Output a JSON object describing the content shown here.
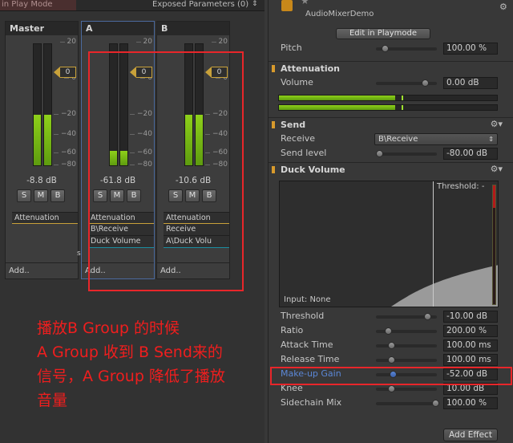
{
  "topbar": {
    "mode": "in Play Mode",
    "exposed": "Exposed Parameters (0)",
    "arrows": "⇕"
  },
  "strips": [
    {
      "name": "Master",
      "db": "-8.8 dB",
      "fader": "0",
      "effects": [
        "Attenuation"
      ],
      "add": "Add..",
      "meter_levels": [
        0.42,
        0.42
      ]
    },
    {
      "name": "A",
      "db": "-61.8 dB",
      "fader": "0",
      "effects": [
        "Attenuation",
        "B\\Receive",
        "Duck Volume"
      ],
      "add": "Add..",
      "meter_levels": [
        0.12,
        0.12
      ]
    },
    {
      "name": "B",
      "db": "-10.6 dB",
      "fader": "0",
      "effects": [
        "Attenuation",
        "Receive",
        "A\\Duck Volu"
      ],
      "add": "Add..",
      "meter_levels": [
        0.42,
        0.42
      ]
    }
  ],
  "buttons": {
    "s": "S",
    "m": "M",
    "b": "B"
  },
  "ticks": [
    "20",
    "0",
    "−20",
    "−40",
    "−60",
    "−80"
  ],
  "annotation": {
    "line1": "播放B Group 的时候",
    "line2": "A Group 收到 B Send来的",
    "line3": "信号，A Group 降低了播放",
    "line4": "音量"
  },
  "inspector": {
    "title": "AudioMixerDemo",
    "edit_button": "Edit in Playmode",
    "pitch": {
      "label": "Pitch",
      "value": "100.00 %",
      "knob": 0.1
    },
    "attenuation": {
      "header": "Attenuation",
      "volume": {
        "label": "Volume",
        "value": "0.00 dB",
        "knob": 0.8
      }
    },
    "send": {
      "header": "Send",
      "receive": {
        "label": "Receive",
        "value": "B\\Receive"
      },
      "level": {
        "label": "Send level",
        "value": "-80.00 dB",
        "knob": 0.0
      }
    },
    "duck": {
      "header": "Duck Volume",
      "threshold_label": "Threshold: -",
      "input_label": "Input: None",
      "params": [
        {
          "label": "Threshold",
          "value": "-10.00 dB",
          "knob": 0.85
        },
        {
          "label": "Ratio",
          "value": "200.00 %",
          "knob": 0.15
        },
        {
          "label": "Attack Time",
          "value": "100.00 ms",
          "knob": 0.2
        },
        {
          "label": "Release Time",
          "value": "100.00 ms",
          "knob": 0.2
        },
        {
          "label": "Make-up Gain",
          "value": "-52.00 dB",
          "knob": 0.25
        },
        {
          "label": "Knee",
          "value": "10.00 dB",
          "knob": 0.2
        },
        {
          "label": "Sidechain Mix",
          "value": "100.00 %",
          "knob": 0.95
        }
      ]
    },
    "add_effect": "Add Effect"
  },
  "colors": {
    "annotation": "#e8262a",
    "meter": "#8ed01a",
    "section_accent": "#d89a2c"
  }
}
